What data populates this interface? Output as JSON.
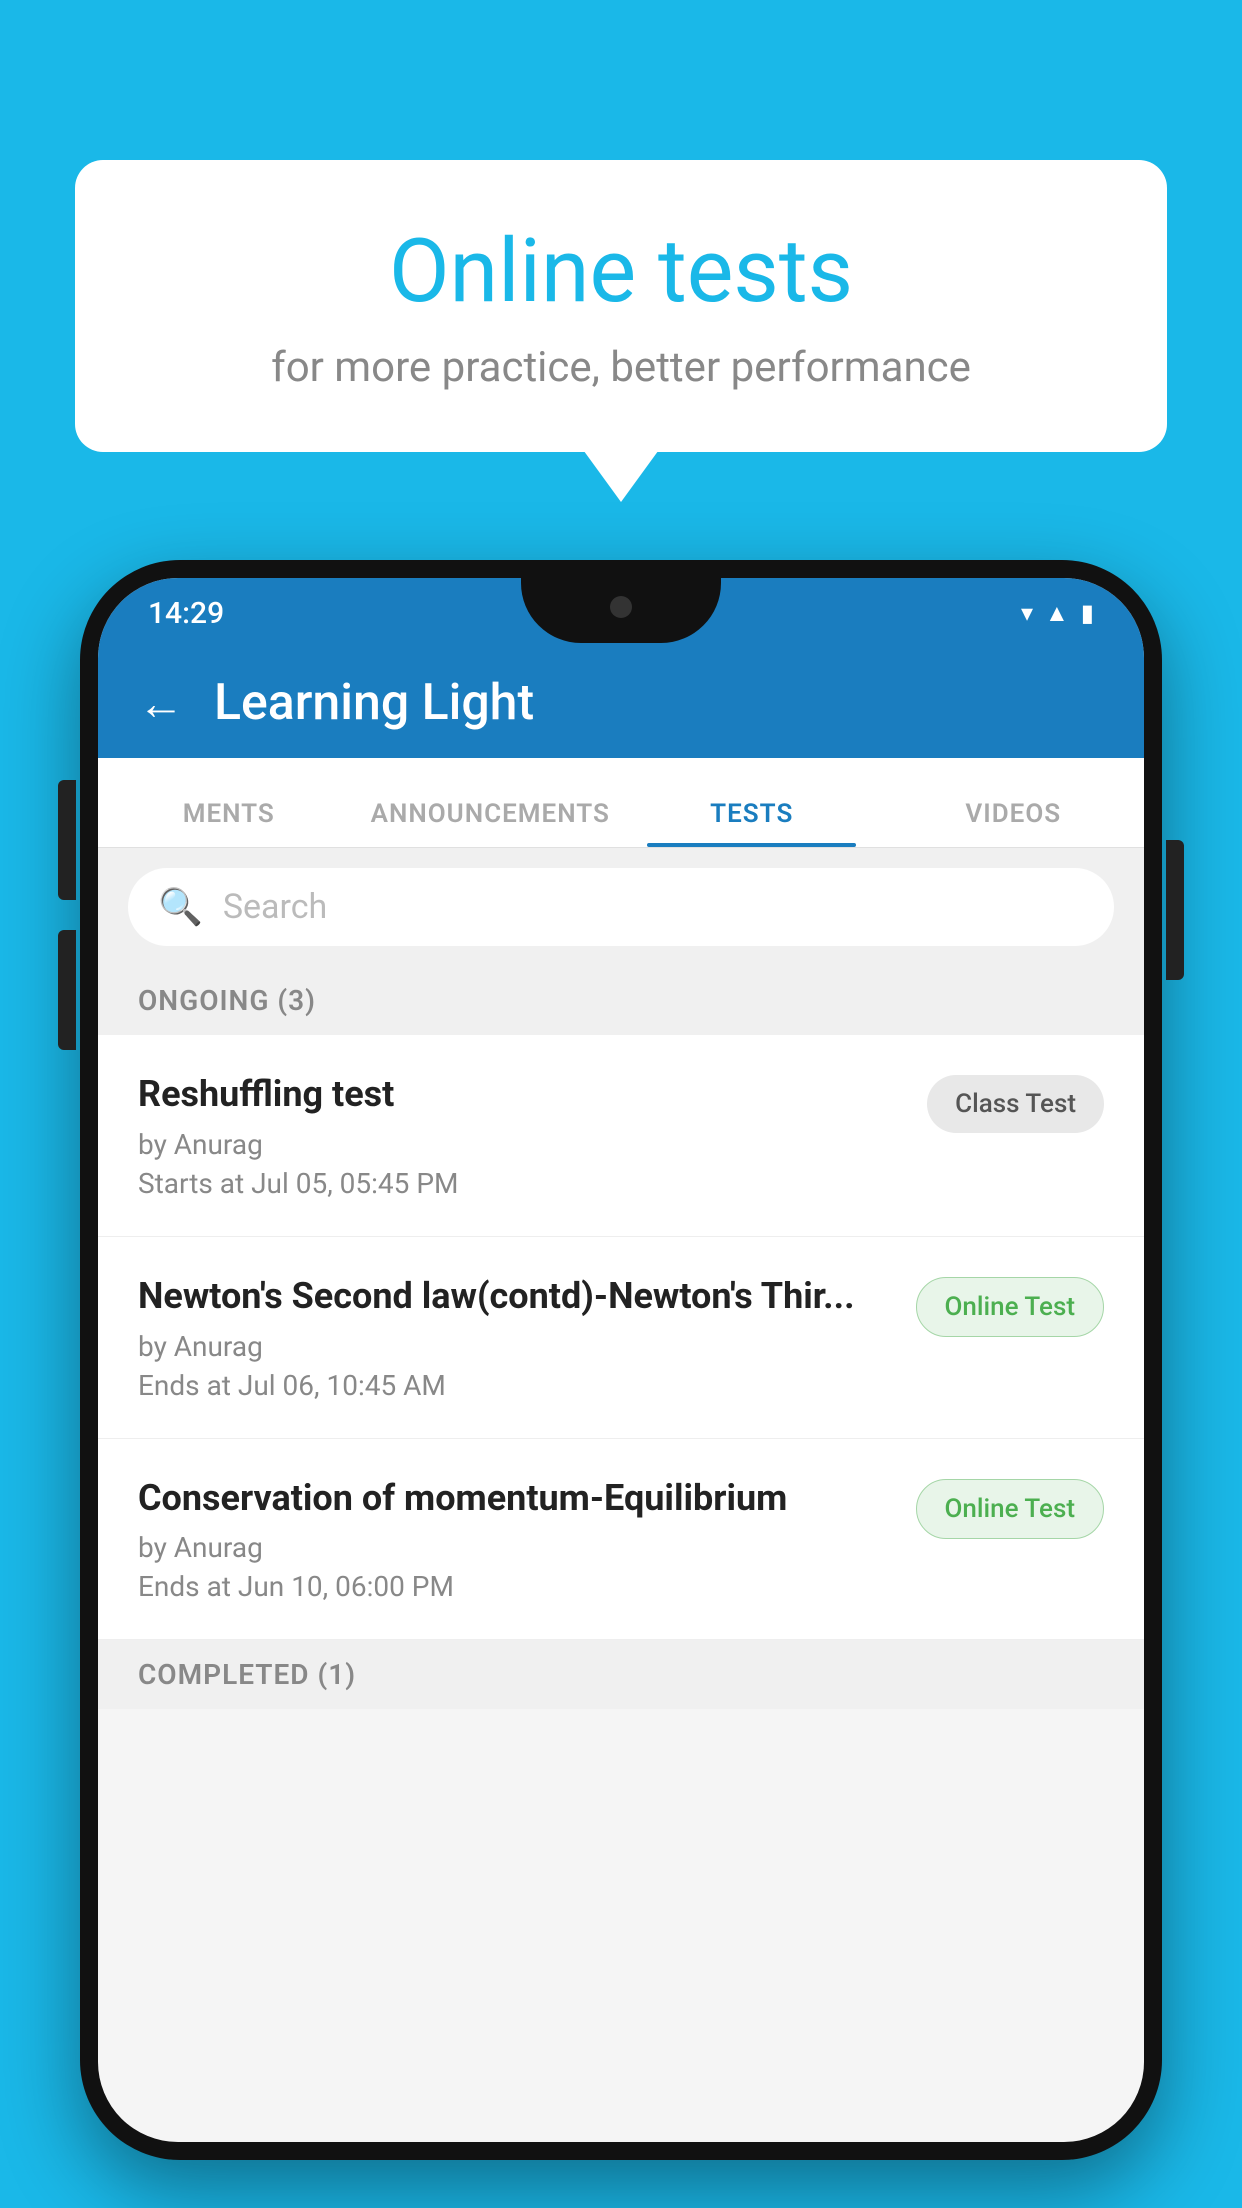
{
  "background_color": "#1ab8e8",
  "speech_bubble": {
    "title": "Online tests",
    "subtitle": "for more practice, better performance"
  },
  "phone": {
    "status_bar": {
      "time": "14:29",
      "icons": [
        "wifi",
        "signal",
        "battery"
      ]
    },
    "header": {
      "back_label": "←",
      "title": "Learning Light"
    },
    "tabs": [
      {
        "label": "MENTS",
        "active": false
      },
      {
        "label": "ANNOUNCEMENTS",
        "active": false
      },
      {
        "label": "TESTS",
        "active": true
      },
      {
        "label": "VIDEOS",
        "active": false
      }
    ],
    "search": {
      "placeholder": "Search"
    },
    "ongoing_section": {
      "label": "ONGOING (3)"
    },
    "tests": [
      {
        "name": "Reshuffling test",
        "by": "by Anurag",
        "date": "Starts at  Jul 05, 05:45 PM",
        "badge": "Class Test",
        "badge_type": "class"
      },
      {
        "name": "Newton's Second law(contd)-Newton's Thir...",
        "by": "by Anurag",
        "date": "Ends at  Jul 06, 10:45 AM",
        "badge": "Online Test",
        "badge_type": "online"
      },
      {
        "name": "Conservation of momentum-Equilibrium",
        "by": "by Anurag",
        "date": "Ends at  Jun 10, 06:00 PM",
        "badge": "Online Test",
        "badge_type": "online"
      }
    ],
    "completed_section": {
      "label": "COMPLETED (1)"
    }
  }
}
